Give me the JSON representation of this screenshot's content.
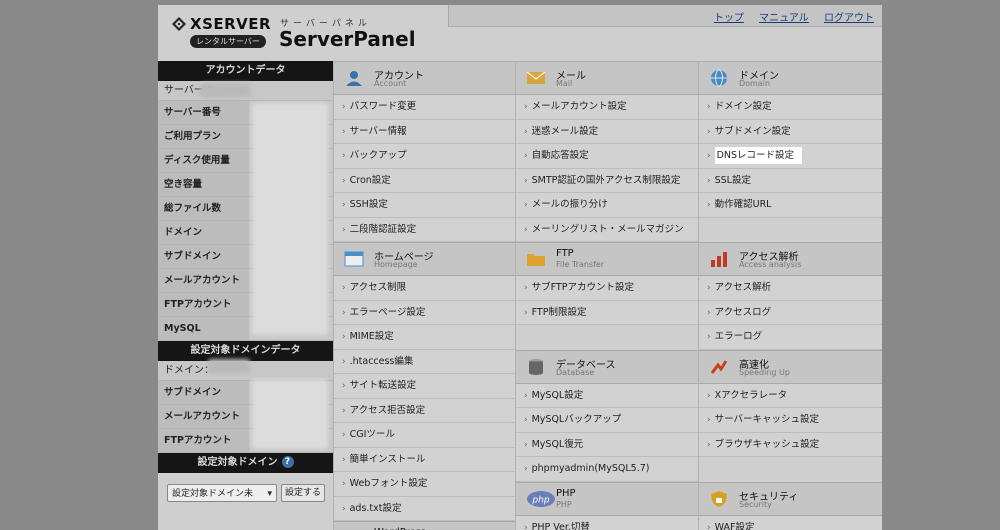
{
  "brand": {
    "xserver": "XSERVER",
    "badge": "レンタルサーバー",
    "subtitle": "サーバーパネル",
    "title": "ServerPanel"
  },
  "topnav": [
    "トップ",
    "マニュアル",
    "ログアウト"
  ],
  "account_panel": {
    "header": "アカウントデータ",
    "server_id_label": "サーバーID：",
    "rows": [
      "サーバー番号",
      "ご利用プラン",
      "ディスク使用量",
      "空き容量",
      "総ファイル数",
      "ドメイン",
      "サブドメイン",
      "メールアカウント",
      "FTPアカウント",
      "MySQL"
    ]
  },
  "domain_panel": {
    "header": "設定対象ドメインデータ",
    "domain_label": "ドメイン：",
    "rows": [
      "サブドメイン",
      "メールアカウント",
      "FTPアカウント"
    ]
  },
  "domain_select": {
    "header": "設定対象ドメイン",
    "select_value": "設定対象ドメイン未",
    "button": "設定する"
  },
  "col1": [
    {
      "title": "アカウント",
      "sub": "Account",
      "icon": "account-icon",
      "color": "#3b6fb0",
      "items": [
        "パスワード変更",
        "サーバー情報",
        "バックアップ",
        "Cron設定",
        "SSH設定",
        "二段階認証設定"
      ]
    },
    {
      "title": "ホームページ",
      "sub": "Homepage",
      "icon": "homepage-icon",
      "color": "#4a90c8",
      "items": [
        "アクセス制限",
        "エラーページ設定",
        "MIME設定",
        ".htaccess編集",
        "サイト転送設定",
        "アクセス拒否設定",
        "CGIツール",
        "簡単インストール",
        "Webフォント設定",
        "ads.txt設定"
      ]
    },
    {
      "title": "WordPress",
      "sub": "",
      "icon": "wordpress-icon",
      "color": "#333333",
      "items": []
    }
  ],
  "col2": [
    {
      "title": "メール",
      "sub": "Mail",
      "icon": "mail-icon",
      "color": "#d8a640",
      "items": [
        "メールアカウント設定",
        "迷惑メール設定",
        "自動応答設定",
        "SMTP認証の国外アクセス制限設定",
        "メールの振り分け",
        "メーリングリスト・メールマガジン"
      ]
    },
    {
      "title": "FTP",
      "sub": "File Transfer",
      "icon": "ftp-folder-icon",
      "color": "#e0a030",
      "items": [
        "サブFTPアカウント設定",
        "FTP制限設定"
      ]
    },
    {
      "title": "データベース",
      "sub": "Database",
      "icon": "database-icon",
      "color": "#666666",
      "items": [
        "MySQL設定",
        "MySQLバックアップ",
        "MySQL復元",
        "phpmyadmin(MySQL5.7)"
      ]
    },
    {
      "title": "PHP",
      "sub": "PHP",
      "icon": "php-icon",
      "color": "#6a7fb8",
      "items": [
        "PHP Ver.切替"
      ]
    }
  ],
  "col3": [
    {
      "title": "ドメイン",
      "sub": "Domain",
      "icon": "globe-icon",
      "color": "#4a8ac0",
      "items": [
        "ドメイン設定",
        "サブドメイン設定",
        "DNSレコード設定",
        "SSL設定",
        "動作確認URL"
      ]
    },
    {
      "title": "アクセス解析",
      "sub": "Access analysis",
      "icon": "chart-icon",
      "color": "#c03a2a",
      "items": [
        "アクセス解析",
        "アクセスログ",
        "エラーログ"
      ]
    },
    {
      "title": "高速化",
      "sub": "Speeding Up",
      "icon": "speed-icon",
      "color": "#c8401c",
      "items": [
        "Xアクセラレータ",
        "サーバーキャッシュ設定",
        "ブラウザキャッシュ設定"
      ]
    },
    {
      "title": "セキュリティ",
      "sub": "Security",
      "icon": "shield-lock-icon",
      "color": "#d9a020",
      "items": [
        "WAF設定"
      ]
    }
  ],
  "highlighted_item": "DNSレコード設定"
}
